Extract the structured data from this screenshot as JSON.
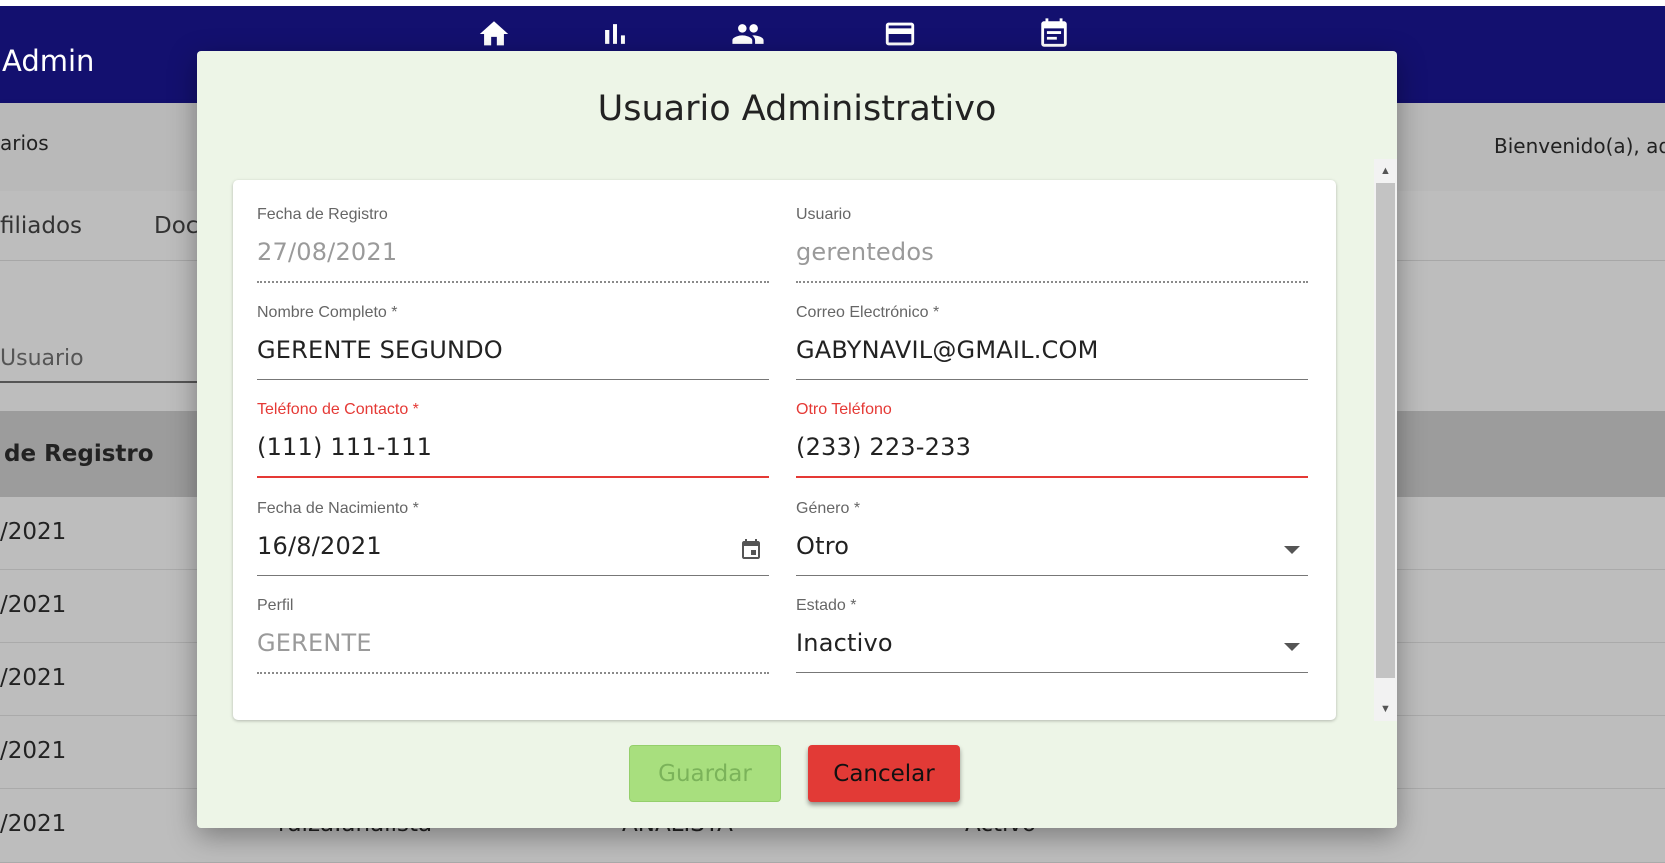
{
  "app": {
    "brand": "Admin",
    "nav_icons": [
      "home-icon",
      "bar-chart-icon",
      "people-icon",
      "credit-card-icon",
      "calendar-note-icon"
    ],
    "subbar_left": "arios",
    "welcome": "Bienvenido(a), adm",
    "tabs": [
      "filiados",
      "Doc"
    ],
    "search_placeholder": "Usuario",
    "table_header": "de Registro",
    "rows": [
      {
        "date": "/2021"
      },
      {
        "date": "/2021"
      },
      {
        "date": "/2021"
      },
      {
        "date": "/2021"
      },
      {
        "date": "/2021",
        "user": "raiza.analista",
        "profile": "ANALISTA",
        "status": "Activo"
      }
    ]
  },
  "modal": {
    "title": "Usuario Administrativo",
    "fields": {
      "fecha_registro": {
        "label": "Fecha de Registro",
        "value": "27/08/2021"
      },
      "usuario": {
        "label": "Usuario",
        "value": "gerentedos"
      },
      "nombre": {
        "label": "Nombre Completo *",
        "value": "GERENTE SEGUNDO"
      },
      "correo": {
        "label": "Correo Electrónico *",
        "value": "GABYNAVIL@GMAIL.COM"
      },
      "telefono": {
        "label": "Teléfono de Contacto *",
        "value": "(111) 111-111"
      },
      "otro_telefono": {
        "label": "Otro Teléfono",
        "value": "(233) 223-233"
      },
      "nacimiento": {
        "label": "Fecha de Nacimiento *",
        "value": "16/8/2021"
      },
      "genero": {
        "label": "Género *",
        "value": "Otro"
      },
      "perfil": {
        "label": "Perfil",
        "value": "GERENTE"
      },
      "estado": {
        "label": "Estado *",
        "value": "Inactivo"
      }
    },
    "buttons": {
      "save": "Guardar",
      "cancel": "Cancelar"
    }
  },
  "colors": {
    "topbar": "#13106f",
    "modal_bg": "#edf5e7",
    "error": "#e53935",
    "save_btn": "#a8df7e",
    "cancel_btn": "#e23a36"
  }
}
